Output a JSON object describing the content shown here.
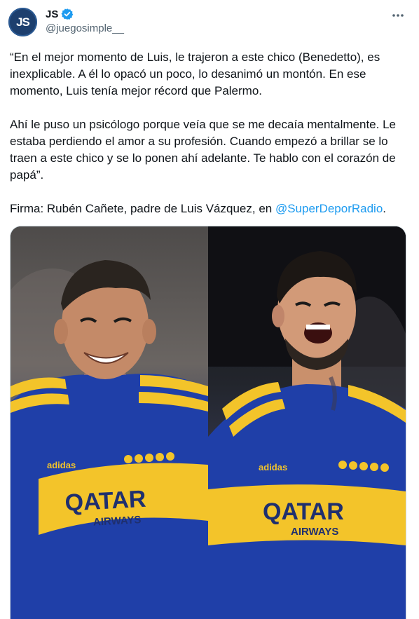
{
  "author": {
    "display_name": "JS",
    "handle": "@juegosimple__",
    "avatar_initials": "JS",
    "verified": true
  },
  "menu": {
    "more_icon": "ellipsis-icon"
  },
  "tweet": {
    "paragraphs": [
      "“En el mejor momento de Luis, le trajeron a este chico (Benedetto), es inexplicable. A él lo opacó un poco, lo desanimó un montón. En ese momento, Luis tenía mejor récord que Palermo.",
      "Ahí le puso un psicólogo porque veía que se me decaía mentalmente. Le estaba perdiendo el amor a su profesión. Cuando empezó a brillar se lo traen a este chico y se lo ponen ahí adelante. Te hablo con el corazón de papá”."
    ],
    "signature_prefix": "Firma: Rubén Cañete, padre de Luis Vázquez, en ",
    "mention": "@SuperDeporRadio",
    "signature_suffix": "."
  },
  "media": {
    "left_photo": {
      "sponsor": "QATAR",
      "sponsor_sub": "AIRWAYS",
      "brand": "adidas"
    },
    "right_photo": {
      "sponsor": "QATAR",
      "sponsor_sub": "AIRWAYS",
      "brand": "adidas"
    }
  },
  "colors": {
    "link": "#1d9bf0",
    "verified": "#1d9bf0",
    "jersey_blue": "#1f3fa8",
    "jersey_yellow": "#f3c42a"
  }
}
